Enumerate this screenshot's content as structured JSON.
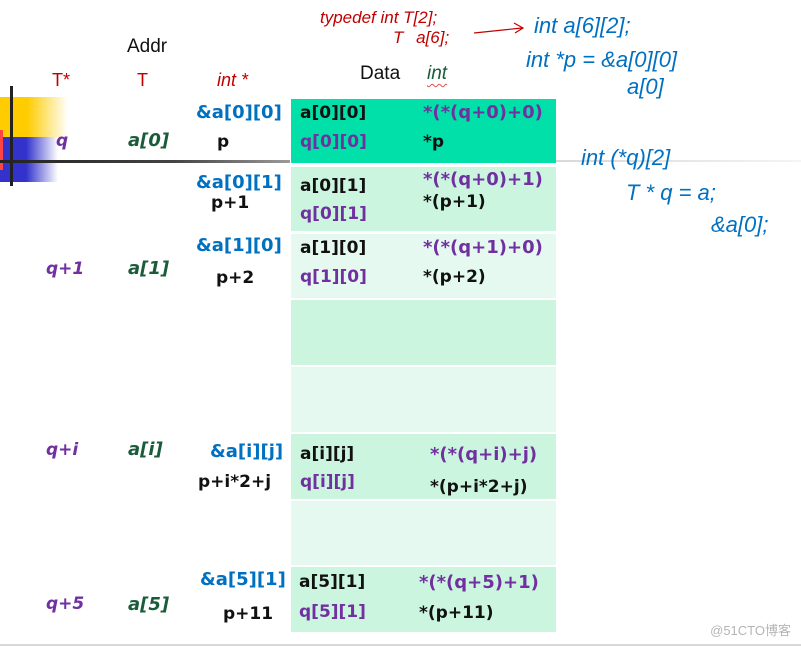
{
  "headers": {
    "addr": "Addr",
    "t_star": "T*",
    "t": "T",
    "int_star": "int *",
    "data": "Data",
    "int": "int"
  },
  "typedef": {
    "line1": "typedef  int    T[2];",
    "line2": "T      a[6];"
  },
  "declarations": {
    "array": "int  a[6][2];",
    "p_init": "int  *p = &a[0][0]",
    "p_alt": "a[0]",
    "q_type": "int (*q)[2]",
    "q_init": "T * q = a;",
    "q_alt": "&a[0];"
  },
  "rows": [
    {
      "q": "q",
      "T": "a[0]",
      "addr": "&a[0][0]",
      "p": "p",
      "elem": "a[0][0]",
      "qelem": "q[0][0]",
      "expr": "*(*(q+0)+0)",
      "deref": "*p",
      "highlight": true
    },
    {
      "addr": "&a[0][1]",
      "p": "p+1",
      "elem": "a[0][1]",
      "qelem": "q[0][1]",
      "expr": "*(*(q+0)+1)",
      "deref": "*(p+1)"
    },
    {
      "q": "q+1",
      "T": "a[1]",
      "addr": "&a[1][0]",
      "p": "p+2",
      "elem": "a[1][0]",
      "qelem": "q[1][0]",
      "expr": "*(*(q+1)+0)",
      "deref": "*(p+2)"
    },
    {
      "empty": true
    },
    {
      "empty": true
    },
    {
      "q": "q+i",
      "T": "a[i]",
      "addr": "&a[i][j]",
      "p": "p+i*2+j",
      "elem": "a[i][j]",
      "qelem": "q[i][j]",
      "expr": "*(*(q+i)+j)",
      "deref": "*(p+i*2+j)"
    },
    {
      "empty": true
    },
    {
      "q": "q+5",
      "T": "a[5]",
      "addr": "&a[5][1]",
      "p": "p+11",
      "elem": "a[5][1]",
      "qelem": "q[5][1]",
      "expr": "*(*(q+5)+1)",
      "deref": "*(p+11)"
    }
  ],
  "colors": {
    "highlight_cell": "#00e0a8",
    "cell_a": "#ccf5e0",
    "cell_b": "#e6f9f0",
    "type_red": "#c00000",
    "code_blue": "#0070c0",
    "purple": "#7030a0",
    "dark_green": "#1a5c3a"
  },
  "watermark": "@51CTO博客"
}
